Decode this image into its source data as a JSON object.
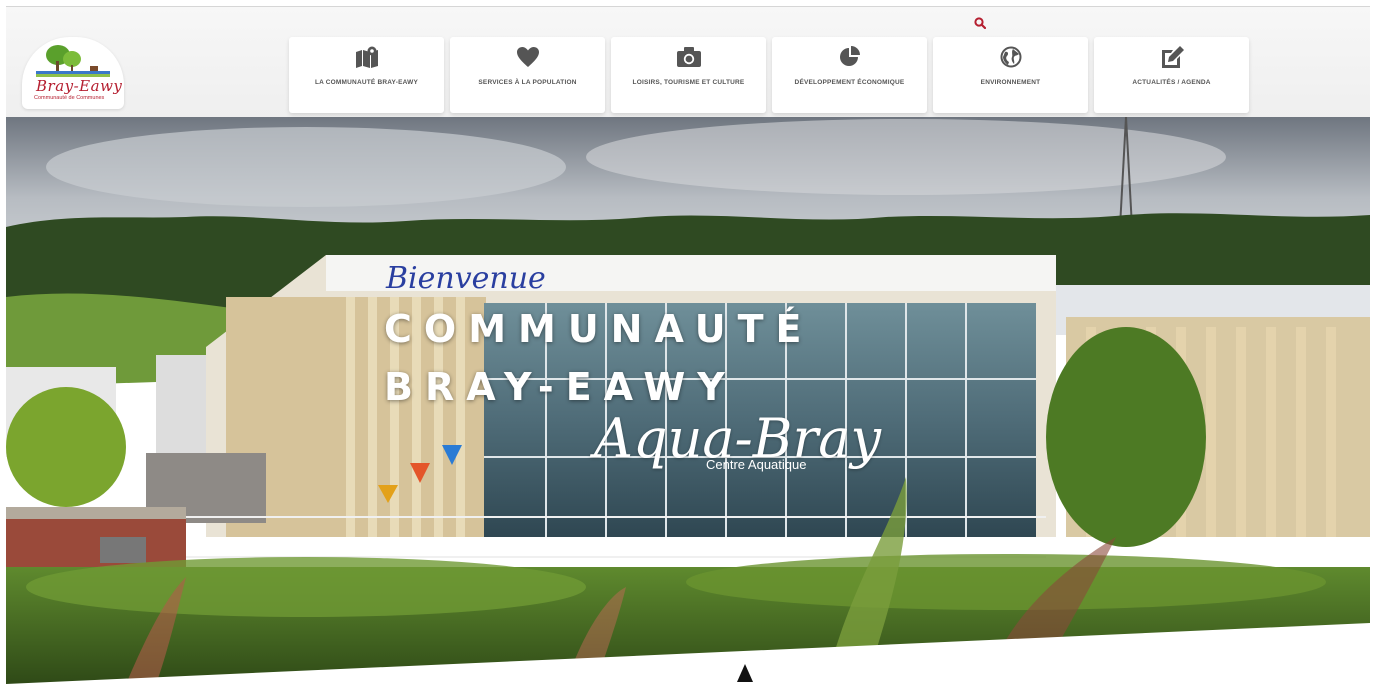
{
  "header": {
    "logo_name": "Bray-Eawy",
    "logo_subtitle": "Communauté de Communes",
    "search_icon": "search-icon",
    "accent_color": "#b51f30"
  },
  "nav": [
    {
      "label": "LA COMMUNAUTÉ BRAY-EAWY",
      "icon": "map-pin-icon"
    },
    {
      "label": "SERVICES À LA POPULATION",
      "icon": "heart-icon"
    },
    {
      "label": "LOISIRS, TOURISME ET CULTURE",
      "icon": "camera-icon"
    },
    {
      "label": "DÉVELOPPEMENT ÉCONOMIQUE",
      "icon": "pie-chart-icon"
    },
    {
      "label": "ENVIRONNEMENT",
      "icon": "globe-icon"
    },
    {
      "label": "ACTUALITÉS / AGENDA",
      "icon": "edit-icon"
    }
  ],
  "hero": {
    "welcome": "Bienvenue",
    "title_line1": "COMMUNAUTÉ",
    "title_line2": "BRAY-EAWY",
    "sign_script": "Aqua-Bray",
    "sign_sub": "Centre Aquatique",
    "welcome_color": "#2a3fa0"
  }
}
